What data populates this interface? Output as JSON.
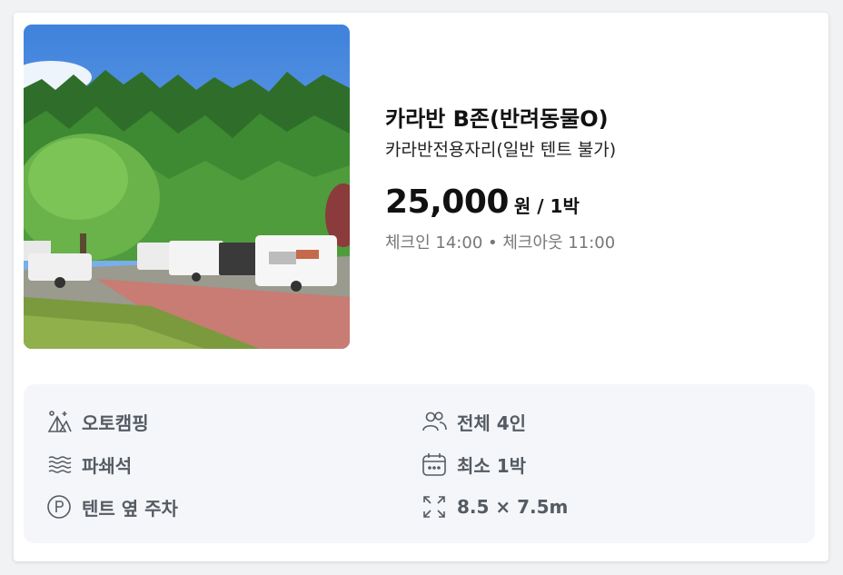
{
  "listing": {
    "title": "카라반 B존(반려동물O)",
    "subtitle": "카라반전용자리(일반 텐트 불가)",
    "price": "25,000",
    "price_unit": "원 / 1박",
    "checkin": "체크인 14:00 • 체크아웃 11:00",
    "photo_icon": "campsite-photo"
  },
  "features": [
    {
      "label": "오토캠핑",
      "icon": "tent-icon"
    },
    {
      "label": "전체 4인",
      "icon": "people-icon"
    },
    {
      "label": "파쇄석",
      "icon": "gravel-icon"
    },
    {
      "label": "최소 1박",
      "icon": "calendar-icon"
    },
    {
      "label": "텐트 옆 주차",
      "icon": "parking-icon"
    },
    {
      "label": "8.5 × 7.5m",
      "icon": "expand-icon"
    }
  ],
  "colors": {
    "feature_bg": "#f4f6f9",
    "feature_text": "#555b63",
    "muted_text": "#777777"
  }
}
